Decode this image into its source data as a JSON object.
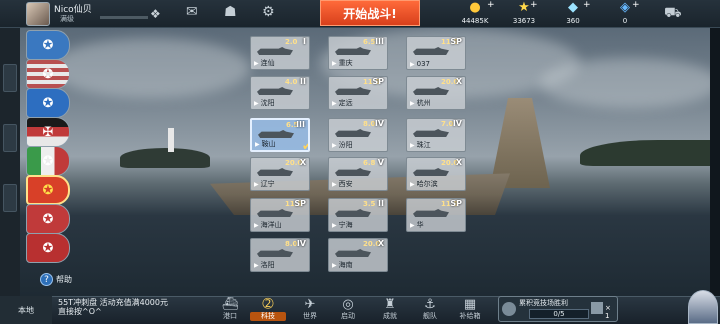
{
  "topbar": {
    "player_name": "Nico仙贝",
    "player_status": "满级",
    "battle_button": "开始战斗!",
    "icons": [
      "wing-emblem-icon",
      "mail-icon",
      "friends-icon",
      "settings-icon"
    ],
    "resources": [
      {
        "icon": "gold-coin-icon",
        "value": "44485K"
      },
      {
        "icon": "star-icon",
        "value": "33673"
      },
      {
        "icon": "diamond-icon",
        "value": "360"
      },
      {
        "icon": "gem-icon",
        "value": "0"
      }
    ],
    "shop_icon": "shop-cart-icon"
  },
  "nations": [
    {
      "id": "nation-1",
      "color": "#3a78c0"
    },
    {
      "id": "nation-2",
      "color": "#b85050"
    },
    {
      "id": "nation-3",
      "color": "#2d6ec0"
    },
    {
      "id": "nation-4",
      "color": "#c03a3a"
    },
    {
      "id": "nation-5",
      "color": "#3a9a4a"
    },
    {
      "id": "nation-6",
      "color": "#d84028",
      "active": true
    },
    {
      "id": "nation-7",
      "color": "#c03a3a"
    },
    {
      "id": "nation-8",
      "color": "#b83030"
    }
  ],
  "help_label": "帮助",
  "ships": [
    {
      "name": "连仙",
      "level": "2.0",
      "tier": "I",
      "selected": false
    },
    {
      "name": "重庆",
      "level": "6.5",
      "tier": "III",
      "selected": false
    },
    {
      "name": "037",
      "level": "11.5",
      "tier": "SP",
      "selected": false
    },
    {
      "name": "沈阳",
      "level": "4.0",
      "tier": "II",
      "selected": false
    },
    {
      "name": "定远",
      "level": "11.5",
      "tier": "SP",
      "selected": false
    },
    {
      "name": "杭州",
      "level": "20.0",
      "tier": "X",
      "selected": false
    },
    {
      "name": "鞍山",
      "level": "6.5",
      "tier": "III",
      "selected": true
    },
    {
      "name": "汾阳",
      "level": "8.0",
      "tier": "IV",
      "selected": false
    },
    {
      "name": "珠江",
      "level": "7.0",
      "tier": "IV",
      "selected": false
    },
    {
      "name": "辽宁",
      "level": "20.0",
      "tier": "X",
      "selected": false
    },
    {
      "name": "西安",
      "level": "6.8",
      "tier": "V",
      "selected": false
    },
    {
      "name": "哈尔滨",
      "level": "20.0",
      "tier": "X",
      "selected": false
    },
    {
      "name": "海洋山",
      "level": "11.5",
      "tier": "SP",
      "selected": false
    },
    {
      "name": "宁海",
      "level": "3.5",
      "tier": "II",
      "selected": false
    },
    {
      "name": "华",
      "level": "11.5",
      "tier": "SP",
      "selected": false
    },
    {
      "name": "洛阳",
      "level": "8.0",
      "tier": "IV",
      "selected": false
    },
    {
      "name": "海南",
      "level": "20.0",
      "tier": "X",
      "selected": false
    }
  ],
  "bottombar": {
    "left_label": "本地",
    "news": "55T冲刺盘 活动充值满4000元直接按^O^",
    "nav": [
      {
        "label": "港口",
        "icon": "port-icon"
      },
      {
        "label": "科技",
        "icon": "tech-icon",
        "active": true
      },
      {
        "label": "世界",
        "icon": "world-icon"
      },
      {
        "label": "启动",
        "icon": "launch-icon"
      },
      {
        "label": "成就",
        "icon": "achievement-icon"
      },
      {
        "label": "舰队",
        "icon": "fleet-icon"
      },
      {
        "label": "补给箱",
        "icon": "supply-box-icon"
      }
    ],
    "task": {
      "label": "累积竞技场胜利",
      "progress": "0/5",
      "count": "× 1"
    }
  }
}
